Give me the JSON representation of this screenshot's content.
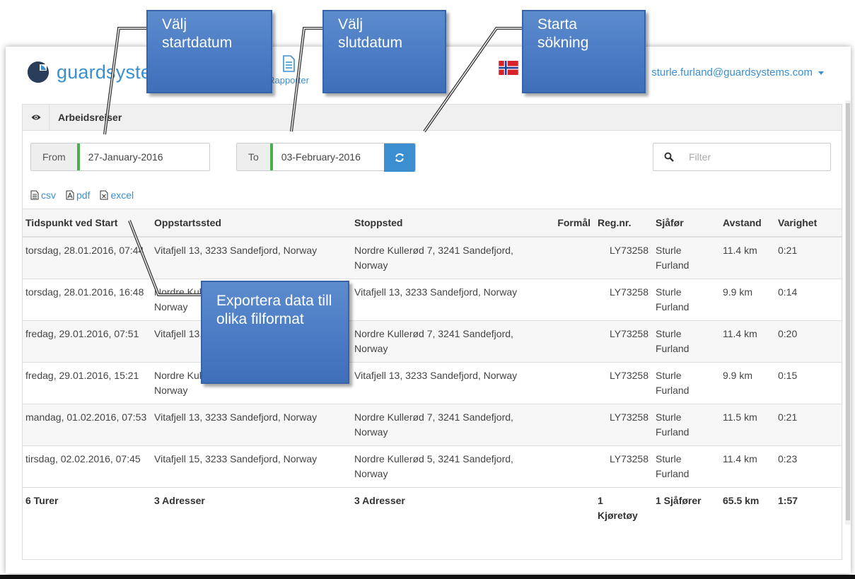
{
  "brand": {
    "logo_text": "guardsystems",
    "accent": "#3b8fd1",
    "green": "#4cae4c"
  },
  "nav": {
    "reports_label": "Rapporter"
  },
  "user": {
    "email": "sturle.furland@guardsystems.com"
  },
  "panel": {
    "title": "Arbeidsreiser"
  },
  "filters": {
    "from_label": "From",
    "from_value": "27-January-2016",
    "to_label": "To",
    "to_value": "03-February-2016",
    "filter_placeholder": "Filter"
  },
  "exports": {
    "csv": "csv",
    "pdf": "pdf",
    "excel": "excel"
  },
  "table": {
    "headers": {
      "start_time": "Tidspunkt ved Start",
      "start_place": "Oppstartssted",
      "stop_place": "Stoppsted",
      "purpose": "Formål",
      "reg": "Reg.nr.",
      "driver": "Sjåfør",
      "distance": "Avstand",
      "duration": "Varighet"
    },
    "rows": [
      {
        "time": "torsdag, 28.01.2016, 07:44",
        "start": "Vitafjell 13, 3233 Sandefjord, Norway",
        "stop": "Nordre Kullerød 7, 3241 Sandefjord, Norway",
        "purpose": "",
        "reg": "LY73258",
        "driver": "Sturle Furland",
        "distance": "11.4 km",
        "duration": "0:21"
      },
      {
        "time": "torsdag, 28.01.2016, 16:48",
        "start": "Nordre Kullerød 7, 3241 Sandefjord, Norway",
        "stop": "Vitafjell 13, 3233 Sandefjord, Norway",
        "purpose": "",
        "reg": "LY73258",
        "driver": "Sturle Furland",
        "distance": "9.9 km",
        "duration": "0:14"
      },
      {
        "time": "fredag, 29.01.2016, 07:51",
        "start": "Vitafjell 13, 3233 Sandefjord, Norway",
        "stop": "Nordre Kullerød 7, 3241 Sandefjord, Norway",
        "purpose": "",
        "reg": "LY73258",
        "driver": "Sturle Furland",
        "distance": "11.4 km",
        "duration": "0:20"
      },
      {
        "time": "fredag, 29.01.2016, 15:21",
        "start": "Nordre Kullerød 5, 3241 Sandefjord, Norway",
        "stop": "Vitafjell 13, 3233 Sandefjord, Norway",
        "purpose": "",
        "reg": "LY73258",
        "driver": "Sturle Furland",
        "distance": "9.9 km",
        "duration": "0:15"
      },
      {
        "time": "mandag, 01.02.2016, 07:53",
        "start": "Vitafjell 13, 3233 Sandefjord, Norway",
        "stop": "Nordre Kullerød 7, 3241 Sandefjord, Norway",
        "purpose": "",
        "reg": "LY73258",
        "driver": "Sturle Furland",
        "distance": "11.5 km",
        "duration": "0:21"
      },
      {
        "time": "tirsdag, 02.02.2016, 07:45",
        "start": "Vitafjell 15, 3233 Sandefjord, Norway",
        "stop": "Nordre Kullerød 5, 3241 Sandefjord, Norway",
        "purpose": "",
        "reg": "LY73258",
        "driver": "Sturle Furland",
        "distance": "11.4 km",
        "duration": "0:23"
      }
    ],
    "totals": {
      "trips": "6 Turer",
      "start_places": "3 Adresser",
      "stop_places": "3 Adresser",
      "vehicles": "1 Kjøretøy",
      "drivers": "1 Sjåfører",
      "distance": "65.5 km",
      "duration": "1:57"
    }
  },
  "callouts": {
    "start_date": "Välj startdatum",
    "end_date": "Välj slutdatum",
    "search": "Starta sökning",
    "export": "Exportera data till olika filformat"
  }
}
